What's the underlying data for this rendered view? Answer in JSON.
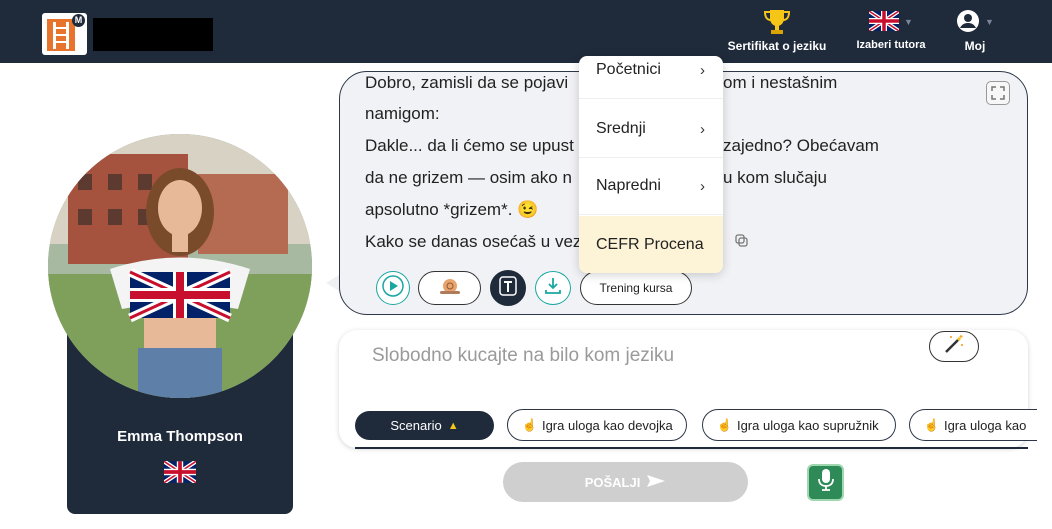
{
  "header": {
    "certificate_label": "Sertifikat o jeziku",
    "tutor_label": "Izaberi tutora",
    "account_label": "Moj"
  },
  "profile": {
    "name": "Emma Thompson"
  },
  "chat": {
    "lines": [
      "Dobro, zamisli da se pojavi",
      "om i nestašnim",
      "namigom:",
      "Dakle... da li ćemo se upust",
      "zajedno? Obećavam",
      "da ne grizem — osim ako n",
      "u kom slučaju",
      "apsolutno *grizem*. 😉",
      "Kako se danas osećaš u vez"
    ],
    "training_label": "Trening kursa"
  },
  "dropdown": {
    "items": [
      {
        "label": "Početnici",
        "chevron": "›"
      },
      {
        "label": "Srednji",
        "chevron": "›"
      },
      {
        "label": "Napredni",
        "chevron": "›"
      },
      {
        "label": "CEFR Procena",
        "chevron": ""
      }
    ]
  },
  "input": {
    "placeholder": "Slobodno kucajte na bilo kom jeziku",
    "scenario_label": "Scenario",
    "roles": [
      "Igra uloga kao devojka",
      "Igra uloga kao supružnik",
      "Igra uloga kao"
    ]
  },
  "actions": {
    "send_label": "POŠALJI"
  },
  "colors": {
    "navy": "#1f2a3b",
    "teal": "#1aa7a1",
    "highlight": "#fdf3d6",
    "mic_green": "#2e8b57"
  },
  "icons": [
    "trophy-icon",
    "uk-flag-icon",
    "user-circle-icon",
    "expand-icon",
    "copy-icon",
    "play-icon",
    "snail-icon",
    "text-icon",
    "download-icon",
    "magic-wand-icon",
    "hand-icon",
    "send-arrow-icon",
    "microphone-icon"
  ]
}
